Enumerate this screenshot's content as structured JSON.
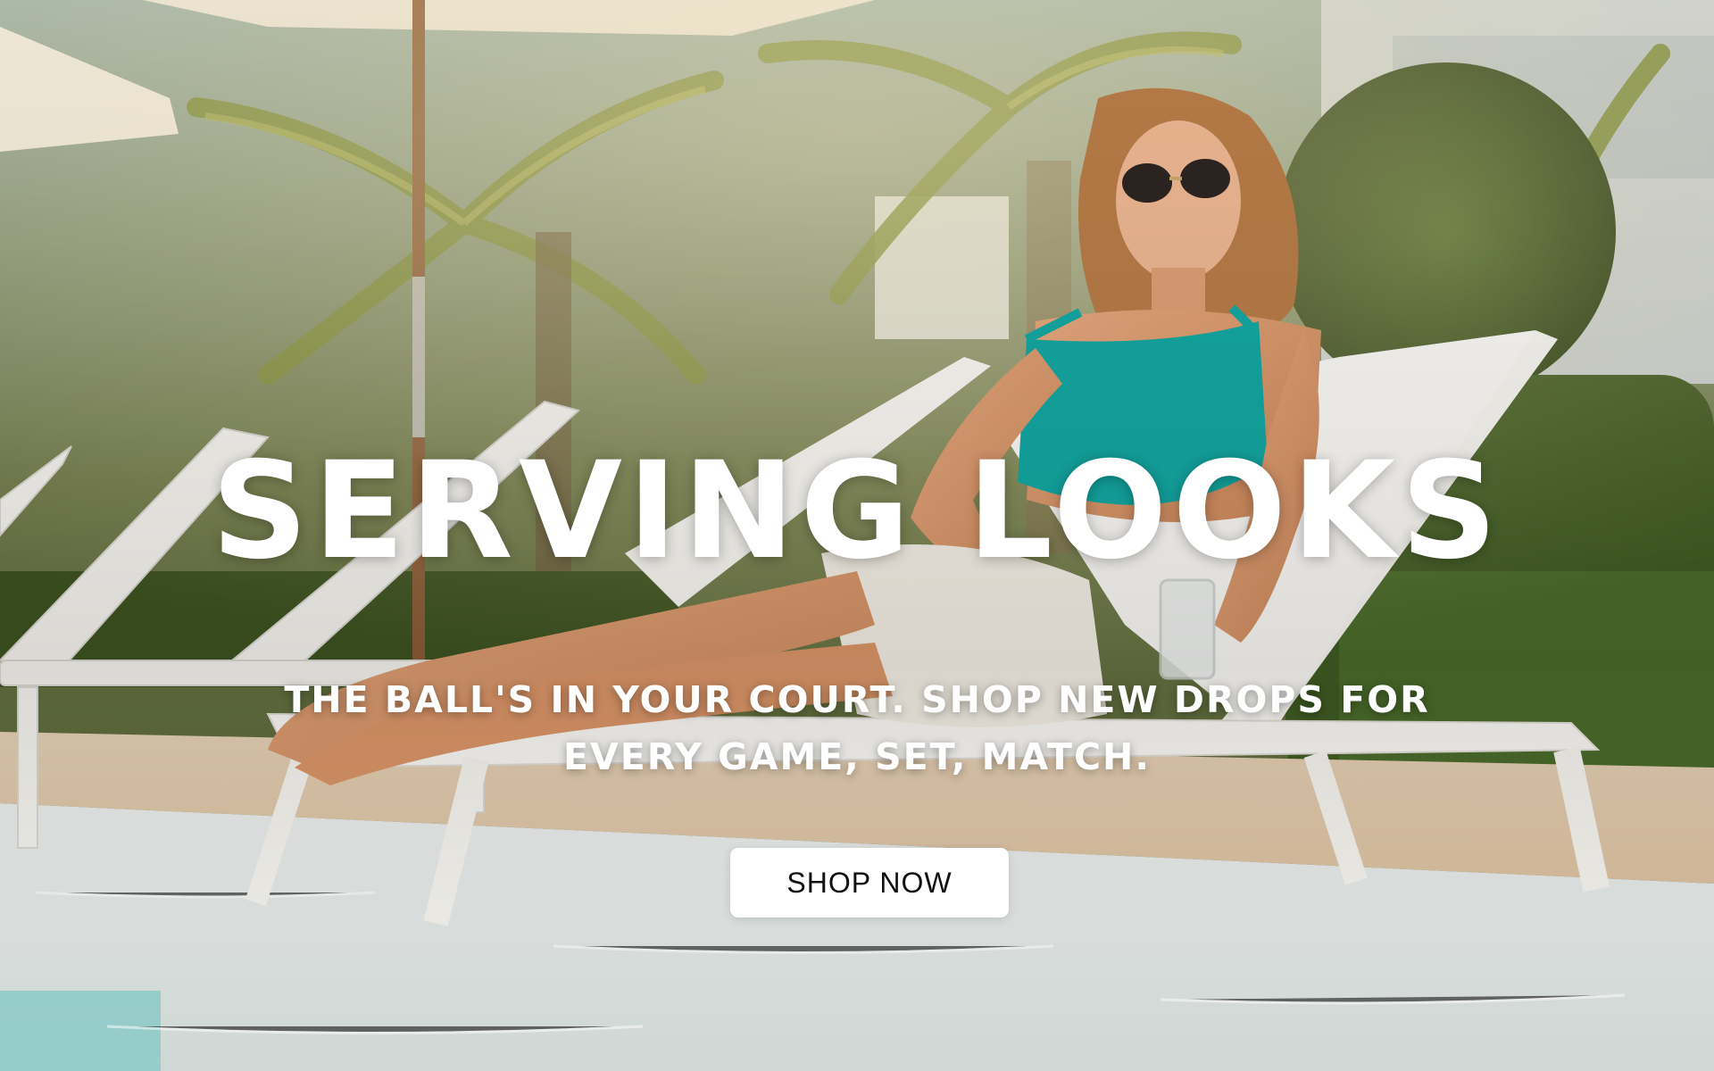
{
  "hero": {
    "headline": "SERVING LOOKS",
    "subheadline": "THE BALL'S IN YOUR COURT. SHOP NEW DROPS FOR EVERY GAME, SET, MATCH.",
    "cta_label": "SHOP NOW"
  },
  "colors": {
    "headline_text": "#ffffff",
    "cta_background": "#ffffff",
    "cta_text": "#111111",
    "swimsuit_accent": "#13a5a0"
  }
}
